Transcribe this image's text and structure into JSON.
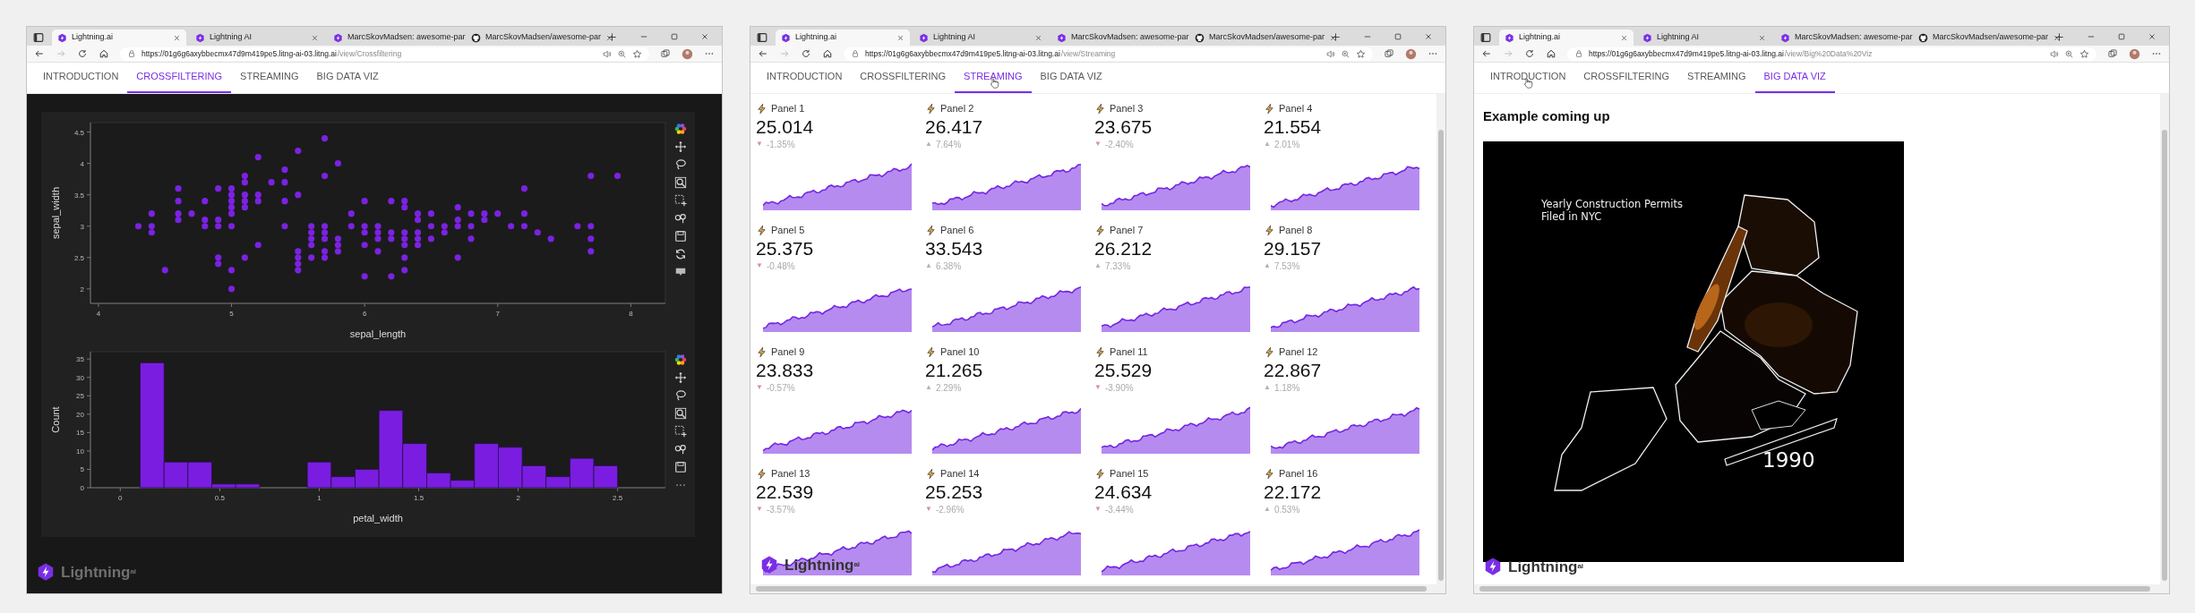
{
  "windows": [
    {
      "browser_tabs": [
        {
          "title": "Lightning.ai",
          "kind": "hexagon",
          "selected": true
        },
        {
          "title": "Lightning AI",
          "kind": "hexagon",
          "selected": false
        },
        {
          "title": "MarcSkovMadsen: awesome-par",
          "kind": "hexagon",
          "selected": false
        },
        {
          "title": "MarcSkovMadsen/awesome-par",
          "kind": "github",
          "selected": false
        }
      ],
      "url": {
        "host": "https://01g6g6axybbecmx47d9m419pe5.litng-ai-03.litng.ai",
        "path": "/view/Crossfiltering"
      },
      "app_tabs": [
        {
          "label": "INTRODUCTION",
          "selected": false,
          "pointer": false
        },
        {
          "label": "CROSSFILTERING",
          "selected": true,
          "pointer": false
        },
        {
          "label": "STREAMING",
          "selected": false,
          "pointer": false
        },
        {
          "label": "BIG DATA VIZ",
          "selected": false,
          "pointer": false
        }
      ],
      "page": {
        "kind": "crossfilter",
        "charts": [
          {
            "chart_data": {
              "type": "scatter",
              "xlabel": "sepal_length",
              "ylabel": "sepal_width",
              "xlim": [
                3.94,
                8.26
              ],
              "ylim": [
                1.77,
                4.65
              ],
              "xticks": [
                4,
                5,
                6,
                7,
                8
              ],
              "yticks": [
                2,
                2.5,
                3,
                3.5,
                4,
                4.5
              ],
              "x": [
                4.3,
                4.4,
                4.4,
                4.4,
                4.5,
                4.6,
                4.6,
                4.6,
                4.6,
                4.7,
                4.8,
                4.8,
                4.8,
                4.9,
                4.9,
                4.9,
                4.9,
                4.9,
                5,
                5,
                5,
                5,
                5,
                5,
                5,
                5,
                5.1,
                5.1,
                5.1,
                5.1,
                5.1,
                5.1,
                5.2,
                5.2,
                5.2,
                5.2,
                5.3,
                5.4,
                5.4,
                5.4,
                5.4,
                5.5,
                5.5,
                5.5,
                5.5,
                5.5,
                5.5,
                5.6,
                5.6,
                5.6,
                5.6,
                5.6,
                5.7,
                5.7,
                5.7,
                5.7,
                5.7,
                5.7,
                5.7,
                5.8,
                5.8,
                5.8,
                5.8,
                5.9,
                5.9,
                6,
                6,
                6,
                6,
                6,
                6.1,
                6.1,
                6.1,
                6.1,
                6.2,
                6.2,
                6.2,
                6.2,
                6.3,
                6.3,
                6.3,
                6.3,
                6.3,
                6.3,
                6.3,
                6.4,
                6.4,
                6.4,
                6.4,
                6.4,
                6.5,
                6.5,
                6.5,
                6.6,
                6.6,
                6.7,
                6.7,
                6.7,
                6.7,
                6.8,
                6.8,
                6.8,
                6.9,
                6.9,
                7,
                7.1,
                7.2,
                7.2,
                7.2,
                7.3,
                7.4,
                7.6,
                7.7,
                7.7,
                7.7,
                7.7,
                7.9
              ],
              "series": [
                {
                  "color": "#7b22e2",
                  "values": [
                    3,
                    3.2,
                    3,
                    2.9,
                    2.3,
                    3.6,
                    3.4,
                    3.2,
                    3.1,
                    3.2,
                    3.4,
                    3.1,
                    3,
                    3.6,
                    3.1,
                    3,
                    2.5,
                    2.4,
                    3.6,
                    3.5,
                    3.4,
                    3.3,
                    3.2,
                    3,
                    2.3,
                    2,
                    3.8,
                    3.7,
                    3.5,
                    3.4,
                    3.3,
                    2.5,
                    4.1,
                    3.5,
                    3.4,
                    2.7,
                    3.7,
                    3.9,
                    3.7,
                    3.4,
                    3,
                    4.2,
                    3.5,
                    2.6,
                    2.5,
                    2.4,
                    2.3,
                    3,
                    2.9,
                    2.8,
                    2.7,
                    2.5,
                    4.4,
                    3.8,
                    3,
                    2.9,
                    2.8,
                    2.6,
                    2.5,
                    4,
                    2.8,
                    2.7,
                    2.6,
                    3.2,
                    3,
                    3.4,
                    3,
                    2.9,
                    2.7,
                    2.2,
                    3,
                    2.9,
                    2.8,
                    2.6,
                    3.4,
                    2.9,
                    2.8,
                    2.2,
                    3.4,
                    3.3,
                    2.9,
                    2.8,
                    2.7,
                    2.5,
                    2.3,
                    3.2,
                    3.1,
                    2.9,
                    2.8,
                    2.7,
                    3.2,
                    3,
                    2.8,
                    3,
                    2.9,
                    3.3,
                    3.1,
                    3,
                    2.5,
                    3.2,
                    3,
                    2.8,
                    3.2,
                    3.1,
                    3.2,
                    3,
                    3.6,
                    3.2,
                    3,
                    2.9,
                    2.8,
                    3,
                    3.8,
                    3,
                    2.8,
                    2.6,
                    3.8
                  ]
                }
              ]
            }
          },
          {
            "chart_data": {
              "type": "bar",
              "xlabel": "petal_width",
              "ylabel": "Count",
              "xlim": [
                -0.15,
                2.74
              ],
              "ylim": [
                0,
                37
              ],
              "xticks": [
                0,
                0.5,
                1,
                1.5,
                2,
                2.5
              ],
              "yticks": [
                0,
                5,
                10,
                15,
                20,
                25,
                30,
                35
              ],
              "x": [
                0.16,
                0.28,
                0.4,
                0.52,
                0.64,
                0.76,
                0.88,
                1,
                1.12,
                1.24,
                1.36,
                1.48,
                1.6,
                1.72,
                1.84,
                1.96,
                2.08,
                2.2,
                2.32,
                2.44
              ],
              "series": [
                {
                  "color": "#7a1de0",
                  "values": [
                    34,
                    7,
                    7,
                    1,
                    1,
                    0,
                    0,
                    7,
                    3,
                    5,
                    21,
                    12,
                    4,
                    2,
                    12,
                    11,
                    6,
                    3,
                    8,
                    6
                  ]
                }
              ]
            }
          }
        ]
      },
      "logo": "Lightning$^{ai}$"
    },
    {
      "browser_tabs": [
        {
          "title": "Lightning.ai",
          "kind": "hexagon",
          "selected": true
        },
        {
          "title": "Lightning AI",
          "kind": "hexagon",
          "selected": false
        },
        {
          "title": "MarcSkovMadsen: awesome-par",
          "kind": "hexagon",
          "selected": false
        },
        {
          "title": "MarcSkovMadsen/awesome-par",
          "kind": "github",
          "selected": false
        }
      ],
      "url": {
        "host": "https://01g6g6axybbecmx47d9m419pe5.litng-ai-03.litng.ai",
        "path": "/view/Streaming"
      },
      "app_tabs": [
        {
          "label": "INTRODUCTION",
          "selected": false,
          "pointer": false
        },
        {
          "label": "CROSSFILTERING",
          "selected": false,
          "pointer": false
        },
        {
          "label": "STREAMING",
          "selected": true,
          "pointer": true
        },
        {
          "label": "BIG DATA VIZ",
          "selected": false,
          "pointer": false
        }
      ],
      "page": {
        "kind": "panels",
        "panels": [
          {
            "title": "Panel 1",
            "value": "25.014",
            "arrow": "▼",
            "color": "#d99099",
            "change": "-1.35%"
          },
          {
            "title": "Panel 2",
            "value": "26.417",
            "arrow": "▲",
            "color": "#b3b3b3",
            "change": "7.64%"
          },
          {
            "title": "Panel 3",
            "value": "23.675",
            "arrow": "▼",
            "color": "#d99099",
            "change": "-2.40%"
          },
          {
            "title": "Panel 4",
            "value": "21.554",
            "arrow": "▲",
            "color": "#b3b3b3",
            "change": "2.01%"
          },
          {
            "title": "Panel 5",
            "value": "25.375",
            "arrow": "▼",
            "color": "#d99099",
            "change": "-0.48%"
          },
          {
            "title": "Panel 6",
            "value": "33.543",
            "arrow": "▲",
            "color": "#b3b3b3",
            "change": "6.38%"
          },
          {
            "title": "Panel 7",
            "value": "26.212",
            "arrow": "▲",
            "color": "#b3b3b3",
            "change": "7.33%"
          },
          {
            "title": "Panel 8",
            "value": "29.157",
            "arrow": "▲",
            "color": "#b3b3b3",
            "change": "7.53%"
          },
          {
            "title": "Panel 9",
            "value": "23.833",
            "arrow": "▼",
            "color": "#d99099",
            "change": "-0.57%"
          },
          {
            "title": "Panel 10",
            "value": "21.265",
            "arrow": "▲",
            "color": "#b3b3b3",
            "change": "2.29%"
          },
          {
            "title": "Panel 11",
            "value": "25.529",
            "arrow": "▼",
            "color": "#d99099",
            "change": "-3.90%"
          },
          {
            "title": "Panel 12",
            "value": "22.867",
            "arrow": "▲",
            "color": "#b3b3b3",
            "change": "1.18%"
          },
          {
            "title": "Panel 13",
            "value": "22.539",
            "arrow": "▼",
            "color": "#d99099",
            "change": "-3.57%"
          },
          {
            "title": "Panel 14",
            "value": "25.253",
            "arrow": "▼",
            "color": "#d99099",
            "change": "-2.96%"
          },
          {
            "title": "Panel 15",
            "value": "24.634",
            "arrow": "▼",
            "color": "#d99099",
            "change": "-3.44%"
          },
          {
            "title": "Panel 16",
            "value": "22.172",
            "arrow": "▲",
            "color": "#b3b3b3",
            "change": "0.53%"
          }
        ]
      },
      "logo": "Lightning$^{ai}$"
    },
    {
      "browser_tabs": [
        {
          "title": "Lightning.ai",
          "kind": "hexagon",
          "selected": true
        },
        {
          "title": "Lightning AI",
          "kind": "hexagon",
          "selected": false
        },
        {
          "title": "MarcSkovMadsen: awesome-par",
          "kind": "hexagon",
          "selected": false
        },
        {
          "title": "MarcSkovMadsen/awesome-par",
          "kind": "github",
          "selected": false
        }
      ],
      "url": {
        "host": "https://01g6g6axybbecmx47d9m419pe5.litng-ai-03.litng.ai",
        "path": "/view/Big%20Data%20Viz"
      },
      "app_tabs": [
        {
          "label": "INTRODUCTION",
          "selected": false,
          "pointer": true
        },
        {
          "label": "CROSSFILTERING",
          "selected": false,
          "pointer": false
        },
        {
          "label": "STREAMING",
          "selected": false,
          "pointer": false
        },
        {
          "label": "BIG DATA VIZ",
          "selected": true,
          "pointer": false
        }
      ],
      "page": {
        "heading": "Example coming up",
        "caption": "Yearly Construction Permits\nFiled in NYC",
        "year": "1990"
      },
      "logo": "Lightning$^{ai}$"
    }
  ]
}
